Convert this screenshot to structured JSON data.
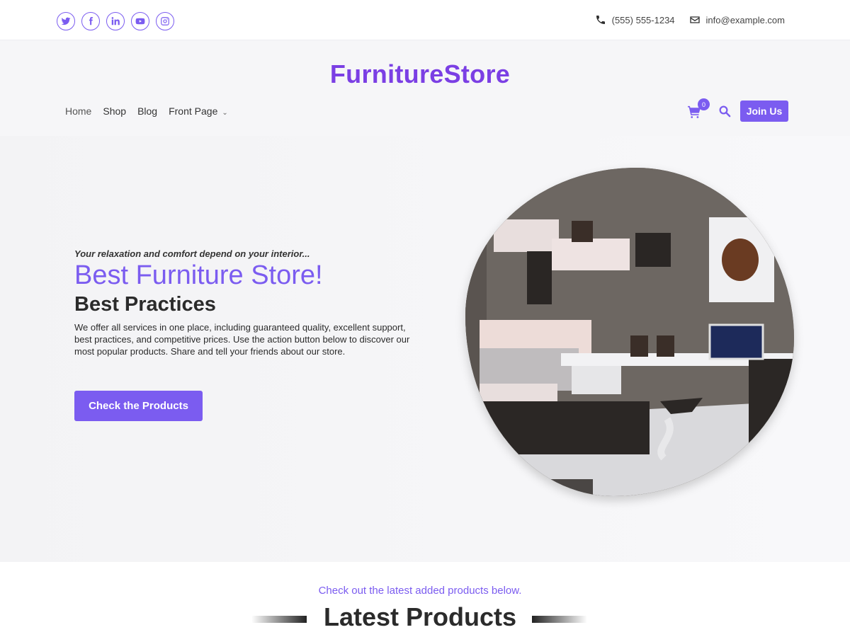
{
  "topbar": {
    "social_icons": [
      "twitter-icon",
      "facebook-icon",
      "linkedin-icon",
      "youtube-icon",
      "instagram-icon"
    ],
    "phone": "(555) 555-1234",
    "email": "info@example.com"
  },
  "header": {
    "logo": "FurnitureStore",
    "nav": [
      {
        "label": "Home"
      },
      {
        "label": "Shop"
      },
      {
        "label": "Blog"
      },
      {
        "label": "Front Page"
      }
    ],
    "cart_count": "0",
    "join_label": "Join Us"
  },
  "hero": {
    "tagline": "Your relaxation and comfort depend on your interior...",
    "title": "Best Furniture Store!",
    "subtitle": "Best Practices",
    "description": "We offer all services in one place, including guaranteed quality, excellent support, best practices, and competitive prices. Use the action button below to discover our most popular products. Share and tell your friends about our store.",
    "cta_label": "Check the Products"
  },
  "latest": {
    "subtitle": "Check out the latest added products below.",
    "title": "Latest Products"
  },
  "colors": {
    "accent": "#7b5cf0",
    "logo": "#7b3fe4",
    "text": "#2b2b2b"
  }
}
